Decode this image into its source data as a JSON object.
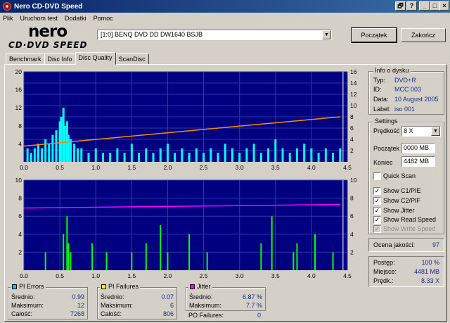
{
  "window": {
    "title": "Nero CD-DVD Speed"
  },
  "titlebar_buttons": [
    "🗗",
    "_",
    "□",
    "×"
  ],
  "menu": [
    "Plik",
    "Uruchom test",
    "Dodatki",
    "Pomoc"
  ],
  "logo": {
    "line1": "nero",
    "line2": "CD·DVD SPEED"
  },
  "drive": {
    "selected": "[1:0]   BENQ DVD DD DW1640 BSJB"
  },
  "buttons": {
    "start": "Początek",
    "end": "Zakończ"
  },
  "tabs": [
    "Benchmark",
    "Disc Info",
    "Disc Quality",
    "ScanDisc"
  ],
  "active_tab": 2,
  "disc_info": {
    "title": "Info o dysku",
    "type_label": "Typ:",
    "type": "DVD+R",
    "id_label": "ID:",
    "id": "MCC 003",
    "date_label": "Data:",
    "date": "10 August 2005",
    "label_label": "Label:",
    "label": "iso 001"
  },
  "settings": {
    "title": "Settings",
    "speed_label": "Prędkość",
    "speed": "8 X",
    "start_label": "Początek",
    "start": "0000 MB",
    "end_label": "Koniec",
    "end": "4482 MB",
    "quick_scan": "Quick Scan",
    "show_c1": "Show C1/PIE",
    "show_c2": "Show C2/PIF",
    "show_jitter": "Show Jitter",
    "show_read": "Show Read Speed",
    "show_write": "Show Write Speed"
  },
  "quality": {
    "label": "Ocena jakości:",
    "value": "97"
  },
  "progress": {
    "progress_label": "Postęp:",
    "progress": "100 %",
    "position_label": "Miejsce:",
    "position": "4481 MB",
    "speed_label": "Prędk.:",
    "speed": "8.33 X"
  },
  "stats": {
    "pi_errors": {
      "title": "PI Errors",
      "color": "#00c8ff",
      "avg_label": "Średnio:",
      "avg": "0.99",
      "max_label": "Maksimum:",
      "max": "12",
      "total_label": "Całość:",
      "total": "7268"
    },
    "pi_failures": {
      "title": "PI Failures",
      "color": "#ffff00",
      "avg_label": "Średnio:",
      "avg": "0.07",
      "max_label": "Maksimum:",
      "max": "6",
      "total_label": "Całość:",
      "total": "806"
    },
    "jitter": {
      "title": "Jitter",
      "color": "#ff00ff",
      "avg_label": "Średnio:",
      "avg": "6.87 %",
      "max_label": "Maksimum:",
      "max": "7.7 %"
    },
    "po_failures_label": "PO Failures:",
    "po_failures": "0"
  },
  "chart_data": [
    {
      "type": "bar",
      "xlim": [
        0,
        4.5
      ],
      "ylim": [
        0,
        20
      ],
      "y2lim": [
        0,
        16
      ],
      "x_ticks": [
        "0.0",
        "0.5",
        "1.0",
        "1.5",
        "2.0",
        "2.5",
        "3.0",
        "3.5",
        "4.0",
        "4.5"
      ],
      "y_ticks": [
        "4",
        "8",
        "12",
        "16",
        "20"
      ],
      "y2_ticks": [
        "2",
        "4",
        "6",
        "8",
        "10",
        "12",
        "14",
        "16"
      ],
      "series": [
        {
          "color": "#00ffff",
          "x": [
            0.05,
            0.1,
            0.15,
            0.2,
            0.25,
            0.3,
            0.35,
            0.4,
            0.45,
            0.5,
            0.52,
            0.55,
            0.57,
            0.6,
            0.62,
            0.65,
            0.7,
            0.75,
            0.8,
            0.9,
            1.0,
            1.1,
            1.2,
            1.3,
            1.4,
            1.5,
            1.6,
            1.7,
            1.8,
            1.9,
            2.0,
            2.1,
            2.2,
            2.3,
            2.4,
            2.5,
            2.6,
            2.7,
            2.8,
            2.9,
            3.0,
            3.1,
            3.2,
            3.3,
            3.4,
            3.5,
            3.6,
            3.7,
            3.8,
            3.9,
            4.0,
            4.1,
            4.2,
            4.3,
            4.4
          ],
          "values": [
            3,
            2,
            3,
            4,
            3,
            5,
            4,
            6,
            7,
            9,
            10,
            12,
            8,
            9,
            6,
            5,
            4,
            3,
            3,
            2,
            3,
            2,
            2,
            3,
            2,
            4,
            2,
            3,
            2,
            3,
            4,
            2,
            3,
            2,
            3,
            2,
            3,
            2,
            4,
            3,
            2,
            3,
            4,
            2,
            3,
            5,
            3,
            2,
            3,
            4,
            3,
            2,
            3,
            2,
            3
          ]
        },
        {
          "color": "#ff8c00",
          "x": [
            0,
            4.4
          ],
          "values": [
            2.8,
            8.0
          ]
        }
      ]
    },
    {
      "type": "bar",
      "xlim": [
        0,
        4.5
      ],
      "ylim": [
        0,
        10
      ],
      "y2lim": [
        0,
        10
      ],
      "x_ticks": [
        "0.0",
        "0.5",
        "1.0",
        "1.5",
        "2.0",
        "2.5",
        "3.0",
        "3.5",
        "4.0",
        "4.5"
      ],
      "y_ticks": [
        "2",
        "4",
        "6",
        "8",
        "10"
      ],
      "y2_ticks": [
        "2",
        "4",
        "6",
        "8",
        "10"
      ],
      "series": [
        {
          "color": "#00ff00",
          "x": [
            0.3,
            0.55,
            0.6,
            0.62,
            0.65,
            0.95,
            1.15,
            1.5,
            1.7,
            1.9,
            2.0,
            2.3,
            2.55,
            3.3,
            3.45,
            3.75,
            3.8,
            4.05,
            4.3
          ],
          "values": [
            2,
            4,
            6,
            3,
            2,
            3,
            2,
            2,
            3,
            5,
            2,
            4,
            2,
            3,
            6,
            2,
            3,
            4,
            2
          ]
        },
        {
          "color": "#ff00ff",
          "x": [
            0,
            4.4
          ],
          "values": [
            6.9,
            7.3
          ]
        }
      ]
    }
  ]
}
